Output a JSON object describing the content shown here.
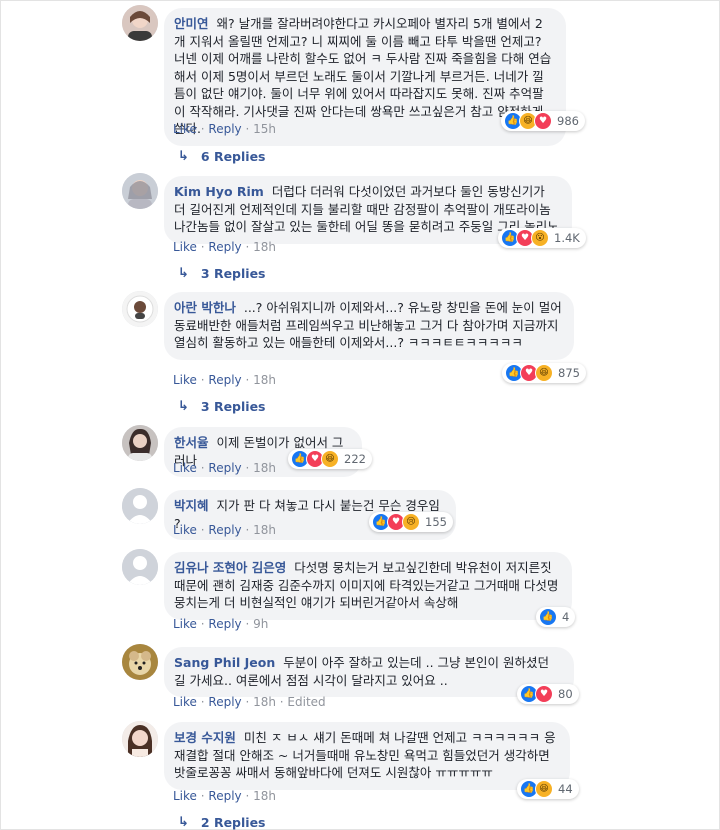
{
  "comments": [
    {
      "name": "안미연",
      "text": "왜? 날개를 잘라버려야한다고 카시오페아 별자리 5개 별에서 2개 지워서 올릴땐 언제고? 니 찌찌에 둘 이름 빼고 타투 박을땐 언제고? 너넨 이제 어깨를 나란히 할수도 없어 ㅋ 두사람 진짜 죽을힘을 다해 연습해서 이제 5명이서 부르던 노래도 둘이서 기깔나게 부르거든. 너네가 낄 틈이 없단 얘기야. 둘이 너무 위에 있어서 따라잡지도 못해. 진짜 추억팔이 작작해라. 기사댓글 진짜 안다는데 쌍욕만 쓰고싶은거 참고 얌전하게 쓴다.",
      "reactions": [
        "like",
        "haha",
        "love"
      ],
      "count": "986",
      "like": "Like",
      "reply": "Reply",
      "time": "15h",
      "replies": "6 Replies"
    },
    {
      "name": "Kim Hyo Rim",
      "text": "더럽다 더러워 다섯이었던 과거보다 둘인 동방신기가 더 길어진게 언제적인데 지들 불리할 때만 감정팔이 추억팔이 개또라이놈 나간놈들 없이 잘살고 있는 둘한테 어딜 똥을 묻히려고 주둥일 그리 놀리노",
      "reactions": [
        "like",
        "love",
        "wow"
      ],
      "count": "1.4K",
      "like": "Like",
      "reply": "Reply",
      "time": "18h",
      "replies": "3 Replies"
    },
    {
      "name": "아란 박한나",
      "text": "...? 아쉬워지니까 이제와서...? 유노랑 창민을 돈에 눈이 멀어 동료배반한 애들처럼 프레임씌우고 비난해놓고 그거 다 참아가며 지금까지 열심히 활동하고 있는 애들한테 이제와서...? ㅋㅋㅋㅌㅌㅋㅋㅋㅋㅋ",
      "reactions": [
        "like",
        "love",
        "haha"
      ],
      "count": "875",
      "like": "Like",
      "reply": "Reply",
      "time": "18h",
      "replies": "3 Replies"
    },
    {
      "name": "한서율",
      "text": "이제 돈벌이가 없어서 그러나",
      "reactions": [
        "like",
        "love",
        "haha"
      ],
      "count": "222",
      "like": "Like",
      "reply": "Reply",
      "time": "18h"
    },
    {
      "name": "박지혜",
      "text": "지가 판 다 쳐놓고 다시 붙는건 무슨 경우임 ?",
      "reactions": [
        "like",
        "love",
        "sad"
      ],
      "count": "155",
      "like": "Like",
      "reply": "Reply",
      "time": "18h"
    },
    {
      "name": "김유나 조현아 김은영",
      "text": "다섯명 뭉치는거 보고싶긴한데 박유천이 저지른짓때문에 괜히 김재중 김준수까지 이미지에 타격있는거같고 그거때매 다섯명 뭉치는게 더 비현실적인 얘기가 되버린거같아서 속상해",
      "reactions": [
        "like"
      ],
      "count": "4",
      "like": "Like",
      "reply": "Reply",
      "time": "9h"
    },
    {
      "name": "Sang Phil Jeon",
      "text": "두분이 아주 잘하고 있는데 .. 그냥 본인이 원하셨던 길 가세요.. 여론에서 점점 시각이 달라지고 있어요 ..",
      "reactions": [
        "like",
        "love"
      ],
      "count": "80",
      "like": "Like",
      "reply": "Reply",
      "time": "18h",
      "edited": "Edited"
    },
    {
      "name": "보경 수지원",
      "text": "미친 ㅈ ㅂㅅ 섀기 돈때메 쳐 나갈땐 언제고 ㅋㅋㅋㅋㅋㅋ 응 재결합 절대 안해조 ~ 너거들때매 유노창민 욕먹고 힘들었던거 생각하면 밧줄로꽁꽁 싸매서 동해앞바다에 던져도 시원찮아 ㅠㅠㅠㅠㅠ",
      "reactions": [
        "like",
        "haha"
      ],
      "count": "44",
      "like": "Like",
      "reply": "Reply",
      "time": "18h",
      "replies": "2 Replies"
    }
  ],
  "icons": {
    "like": "thumbs-up-icon",
    "love": "heart-icon",
    "haha": "laughing-face-icon",
    "wow": "wow-face-icon",
    "sad": "sad-face-icon",
    "reply_arrow": "reply-arrow-icon"
  },
  "colors": {
    "name": "#385898",
    "bubble": "#f2f3f5",
    "like": "#1877f2",
    "love": "#f33e58",
    "face": "#f7b125"
  }
}
